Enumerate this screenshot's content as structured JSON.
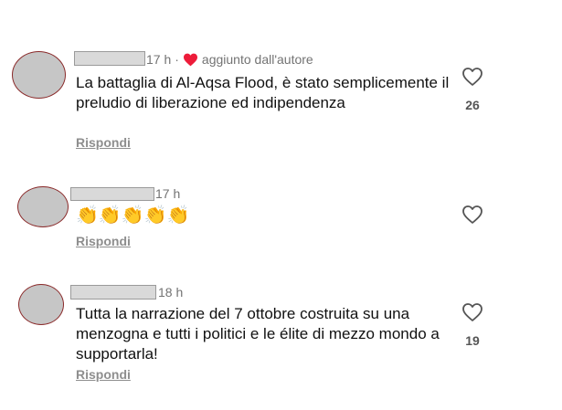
{
  "comments": [
    {
      "time": "17 h",
      "separator": "·",
      "author_badge": "aggiunto dall'autore",
      "text": "La battaglia di Al-Aqsa Flood, è stato semplicemente il preludio di liberazione ed indipendenza",
      "reply_label": "Rispondi",
      "like_count": "26"
    },
    {
      "time": "17 h",
      "text": "👏👏👏👏👏",
      "reply_label": "Rispondi",
      "like_count": ""
    },
    {
      "time": "18 h",
      "text": "Tutta la narrazione del 7 ottobre costruita su una menzogna e tutti i politici e le élite di mezzo mondo a supportarla!",
      "reply_label": "Rispondi",
      "like_count": "19"
    }
  ],
  "icons": {
    "like": "heart-outline-icon",
    "author_like": "heart-filled-icon"
  },
  "colors": {
    "author_heart": "#ed1c3a",
    "meta_text": "#737373",
    "reply_text": "#8e8e8e",
    "avatar_placeholder": "#c6c6c6"
  }
}
